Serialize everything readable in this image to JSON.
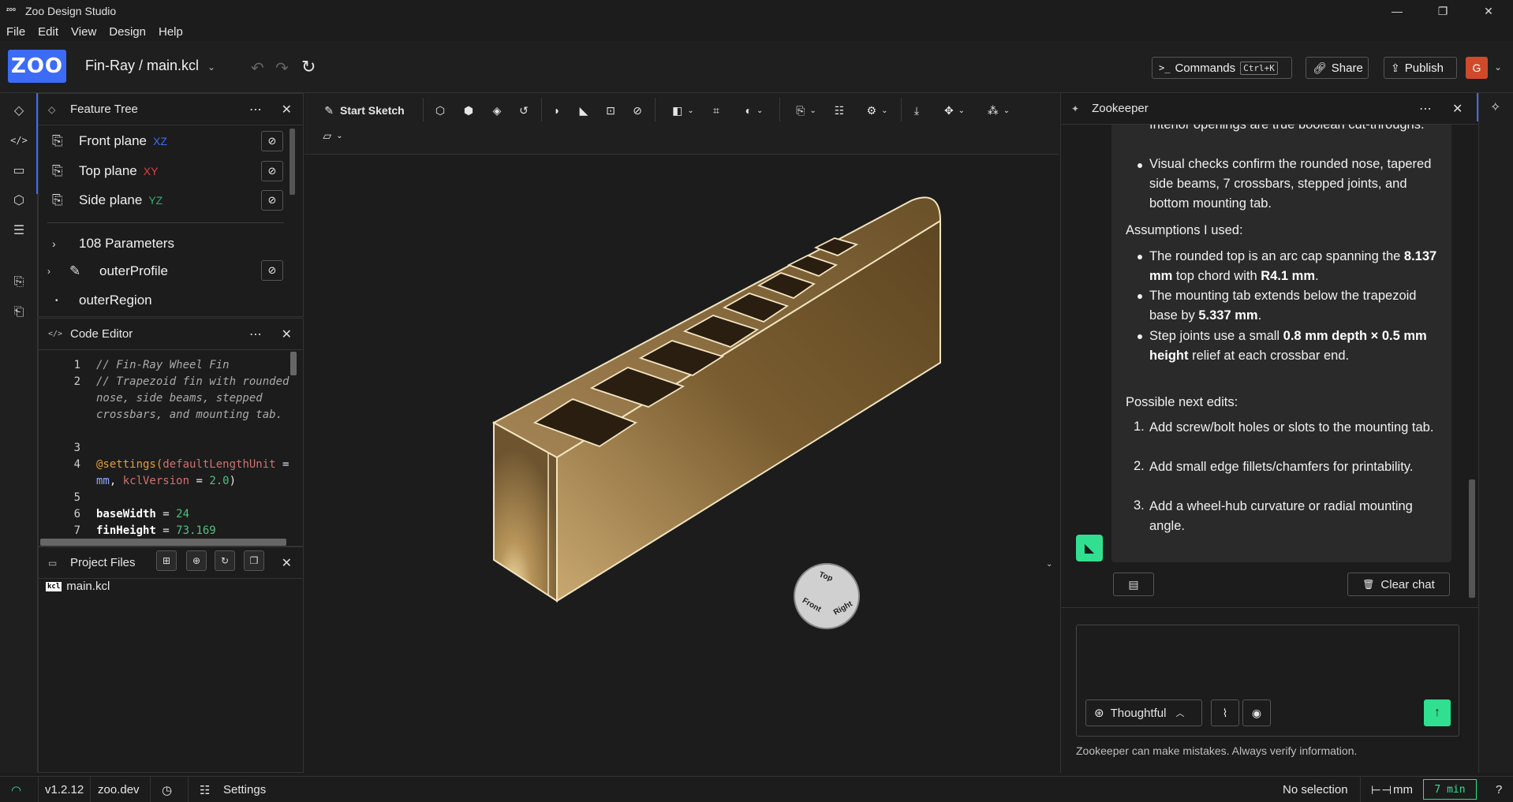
{
  "window": {
    "title": "Zoo Design Studio",
    "minimize": "—",
    "maximize": "❐",
    "close": "✕"
  },
  "menu": [
    "File",
    "Edit",
    "View",
    "Design",
    "Help"
  ],
  "topbar": {
    "logo": "ZOO",
    "project": "Fin-Ray / main.kcl",
    "commands_label": "Commands",
    "commands_shortcut": "Ctrl+K",
    "share_label": "Share",
    "publish_label": "Publish",
    "avatar_initial": "G"
  },
  "feature_tree": {
    "title": "Feature Tree",
    "planes": [
      {
        "name": "Front plane",
        "axis": "XZ",
        "axis_color": "#3c6cf6"
      },
      {
        "name": "Top plane",
        "axis": "XY",
        "axis_color": "#e04040"
      },
      {
        "name": "Side plane",
        "axis": "YZ",
        "axis_color": "#30b070"
      }
    ],
    "parameters": "108 Parameters",
    "profile": "outerProfile",
    "region": "outerRegion"
  },
  "code_editor": {
    "title": "Code Editor",
    "lines": [
      {
        "n": "1",
        "t": "// Fin-Ray Wheel Fin"
      },
      {
        "n": "2",
        "t": "// Trapezoid fin with rounded nose, side beams, stepped crossbars, and mounting tab."
      },
      {
        "n": "3",
        "t": ""
      },
      {
        "n": "4",
        "t_kw": "@settings(",
        "t_fn": "defaultLengthUnit",
        "t_rest1": " = ",
        "t_var1": "mm",
        "t_rest2": ", ",
        "t_fn2": "kclVersion",
        "t_rest3": " = ",
        "t_num": "2.0",
        "t_rest4": ")"
      },
      {
        "n": "5",
        "t": ""
      },
      {
        "n": "6",
        "ident": "baseWidth",
        "eq": " = ",
        "val": "24"
      },
      {
        "n": "7",
        "ident": "finHeight",
        "eq": " = ",
        "val": "73.169"
      }
    ]
  },
  "project_files": {
    "title": "Project Files",
    "file": "main.kcl",
    "file_icon": "kcl"
  },
  "toolbar": {
    "start_sketch": "Start Sketch"
  },
  "zookeeper": {
    "title": "Zookeeper",
    "top_bullets": [
      "Interior openings are true boolean cut-throughs.",
      "Visual checks confirm the rounded nose, tapered side beams, 7 crossbars, stepped joints, and bottom mounting tab."
    ],
    "assumptions_title": "Assumptions I used:",
    "a1_pre": "The rounded top is an arc cap spanning the ",
    "a1_b1": "8.137 mm",
    "a1_mid": " top chord with ",
    "a1_b2": "R4.1 mm",
    "a1_post": ".",
    "a2_pre": "The mounting tab extends below the trapezoid base by ",
    "a2_b": "5.337 mm",
    "a2_post": ".",
    "a3_pre": "Step joints use a small ",
    "a3_b": "0.8 mm depth × 0.5 mm height",
    "a3_post": " relief at each crossbar end.",
    "next_title": "Possible next edits:",
    "next": [
      "Add screw/bolt holes or slots to the mounting tab.",
      "Add small edge fillets/chamfers for printability.",
      "Add a wheel-hub curvature or radial mounting angle."
    ],
    "clear_chat": "Clear chat",
    "mode": "Thoughtful",
    "disclaimer": "Zookeeper can make mistakes. Always verify information."
  },
  "viewcube": {
    "top": "Top",
    "front": "Front",
    "right": "Right"
  },
  "status": {
    "version": "v1.2.12",
    "site": "zoo.dev",
    "settings": "Settings",
    "selection": "No selection",
    "unit": "mm",
    "timer": "7 min",
    "help": "?"
  }
}
